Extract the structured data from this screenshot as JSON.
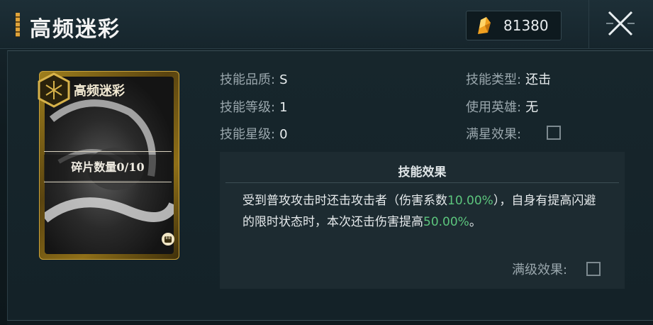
{
  "header": {
    "title": "高频迷彩",
    "currency_icon": "gold-crystal-icon",
    "currency_value": "81380",
    "close_icon": "close-icon"
  },
  "card": {
    "name": "高频迷彩",
    "fragment_label": "碎片数量0/10",
    "emblem_icon": "hex-emblem-icon",
    "type_icon": "fist-icon"
  },
  "info": {
    "quality_label": "技能品质:",
    "quality_value": "S",
    "level_label": "技能等级:",
    "level_value": "1",
    "star_label": "技能星级:",
    "star_value": "0",
    "type_label": "技能类型:",
    "type_value": "还击",
    "hero_label": "使用英雄:",
    "hero_value": "无",
    "full_star_label": "满星效果:"
  },
  "effect": {
    "title": "技能效果",
    "text_part1": "受到普攻攻击时还击攻击者（伤害系数",
    "coef": "10.00%",
    "text_part2": "），自身有提高闪避的限时状态时，本次还击伤害提高",
    "bonus": "50.00%",
    "text_part3": "。",
    "full_level_label": "满级效果:"
  },
  "colors": {
    "accent_gold": "#e0a43a",
    "highlight_green": "#5cc57d",
    "panel_bg": "#1d2b31"
  }
}
